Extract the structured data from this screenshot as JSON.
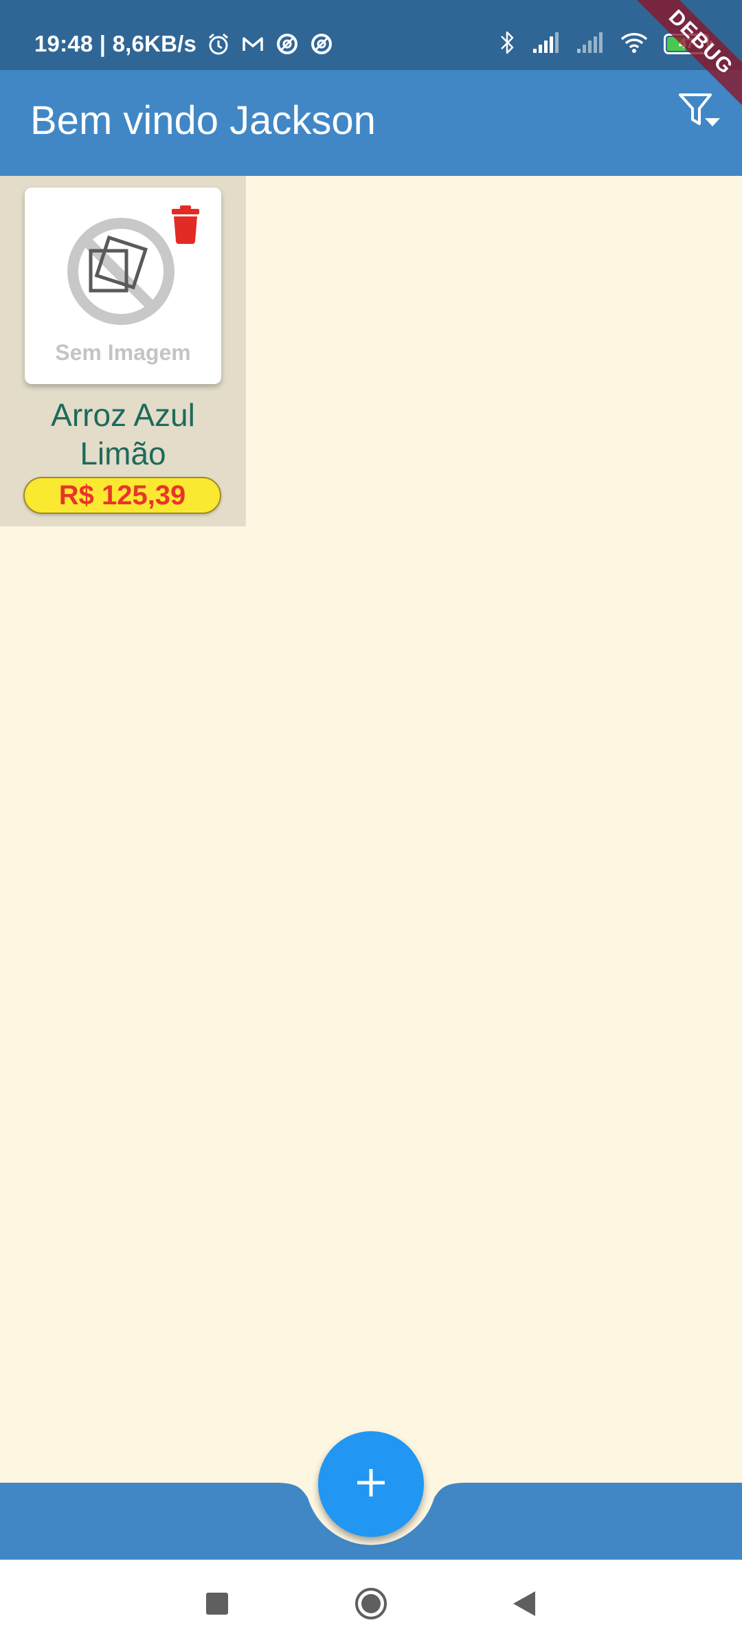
{
  "status_bar": {
    "time_speed": "19:48 | 8,6KB/s",
    "battery": "47",
    "icons": [
      "alarm-icon",
      "gmail-icon",
      "app-icon",
      "app-icon",
      "bluetooth-icon",
      "signal-icon",
      "signal-icon",
      "wifi-icon",
      "battery-icon"
    ]
  },
  "debug_banner": "DEBUG",
  "app_bar": {
    "title": "Bem vindo Jackson",
    "filter_icon": "filter-icon"
  },
  "products": [
    {
      "image_placeholder": "Sem Imagem",
      "name_line1": "Arroz Azul",
      "name_line2": "Limão",
      "price": "R$ 125,39"
    }
  ],
  "fab": {
    "icon": "plus-icon"
  },
  "colors": {
    "status_bar": "#2f6696",
    "app_bar": "#4187c5",
    "background": "#fdf6e1",
    "card": "#e2dcc9",
    "product_name": "#1e6a5b",
    "price_bg": "#fbe830",
    "price_text": "#e8352b",
    "fab": "#2196f3"
  },
  "nav_bar": {
    "icons": [
      "recents-icon",
      "home-icon",
      "back-icon"
    ]
  }
}
